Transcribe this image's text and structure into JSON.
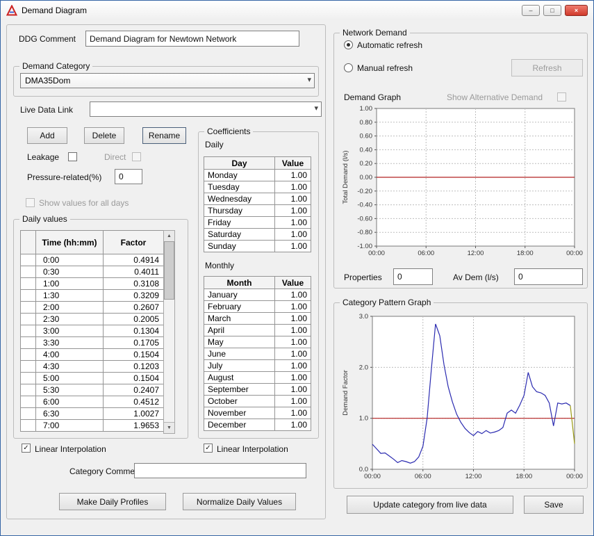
{
  "window": {
    "title": "Demand Diagram"
  },
  "icons": {
    "minimize": "–",
    "maximize": "□",
    "close": "×",
    "dropdown": "▾",
    "check": "✓",
    "scroll_up": "▲",
    "scroll_down": "▼",
    "row_marker": "▶"
  },
  "left": {
    "ddg_comment_label": "DDG Comment",
    "ddg_comment_value": "Demand Diagram for Newtown Network",
    "demand_category": {
      "group_label": "Demand Category",
      "selected_category": "DMA35Dom",
      "live_data_link_label": "Live Data Link",
      "live_data_link_value": "",
      "add_button": "Add",
      "delete_button": "Delete",
      "rename_button": "Rename",
      "leakage_label": "Leakage",
      "direct_label": "Direct",
      "pressure_related_label": "Pressure-related(%)",
      "pressure_related_value": "0",
      "show_values_label": "Show values for all days"
    },
    "daily_values": {
      "group_label": "Daily values",
      "columns": [
        "Time (hh:mm)",
        "Factor"
      ],
      "rows": [
        [
          "0:00",
          "0.4914"
        ],
        [
          "0:30",
          "0.4011"
        ],
        [
          "1:00",
          "0.3108"
        ],
        [
          "1:30",
          "0.3209"
        ],
        [
          "2:00",
          "0.2607"
        ],
        [
          "2:30",
          "0.2005"
        ],
        [
          "3:00",
          "0.1304"
        ],
        [
          "3:30",
          "0.1705"
        ],
        [
          "4:00",
          "0.1504"
        ],
        [
          "4:30",
          "0.1203"
        ],
        [
          "5:00",
          "0.1504"
        ],
        [
          "5:30",
          "0.2407"
        ],
        [
          "6:00",
          "0.4512"
        ],
        [
          "6:30",
          "1.0027"
        ],
        [
          "7:00",
          "1.9653"
        ]
      ],
      "linear_interpolation_label": "Linear Interpolation"
    },
    "coefficients": {
      "group_label": "Coefficients",
      "daily_label": "Daily",
      "daily_columns": [
        "Day",
        "Value"
      ],
      "daily_rows": [
        [
          "Monday",
          "1.00"
        ],
        [
          "Tuesday",
          "1.00"
        ],
        [
          "Wednesday",
          "1.00"
        ],
        [
          "Thursday",
          "1.00"
        ],
        [
          "Friday",
          "1.00"
        ],
        [
          "Saturday",
          "1.00"
        ],
        [
          "Sunday",
          "1.00"
        ]
      ],
      "monthly_label": "Monthly",
      "monthly_columns": [
        "Month",
        "Value"
      ],
      "monthly_rows": [
        [
          "January",
          "1.00"
        ],
        [
          "February",
          "1.00"
        ],
        [
          "March",
          "1.00"
        ],
        [
          "April",
          "1.00"
        ],
        [
          "May",
          "1.00"
        ],
        [
          "June",
          "1.00"
        ],
        [
          "July",
          "1.00"
        ],
        [
          "August",
          "1.00"
        ],
        [
          "September",
          "1.00"
        ],
        [
          "October",
          "1.00"
        ],
        [
          "November",
          "1.00"
        ],
        [
          "December",
          "1.00"
        ]
      ],
      "linear_interpolation_label": "Linear Interpolation"
    },
    "category_comment_label": "Category Comment",
    "category_comment_value": "",
    "make_daily_profiles_button": "Make Daily Profiles",
    "normalize_daily_values_button": "Normalize Daily Values"
  },
  "right": {
    "network_demand": {
      "group_label": "Network Demand",
      "automatic_refresh_label": "Automatic refresh",
      "manual_refresh_label": "Manual refresh",
      "refresh_button": "Refresh",
      "demand_graph_label": "Demand Graph",
      "show_alternative_label": "Show Alternative Demand",
      "properties_label": "Properties",
      "properties_value": "0",
      "av_dem_label": "Av Dem (l/s)",
      "av_dem_value": "0"
    },
    "category_pattern_group_label": "Category Pattern Graph",
    "update_button": "Update category from live data",
    "save_button": "Save"
  },
  "chart_data": [
    {
      "id": "demand-graph",
      "type": "line",
      "title": "Demand Graph",
      "ylabel": "Total Demand (l/s)",
      "xlim": [
        0,
        24
      ],
      "ylim": [
        -1,
        1
      ],
      "xticks": [
        0,
        6,
        12,
        18,
        24
      ],
      "xtick_labels": [
        "00:00",
        "06:00",
        "12:00",
        "18:00",
        "00:00"
      ],
      "yticks": [
        1,
        0.8,
        0.6,
        0.4,
        0.2,
        0,
        -0.2,
        -0.4,
        -0.6,
        -0.8,
        -1
      ],
      "ytick_labels": [
        "1.00",
        "0.80",
        "0.60",
        "0.40",
        "0.20",
        "0.00",
        "-0.20",
        "-0.40",
        "-0.60",
        "-0.80",
        "-1.00"
      ],
      "grid": true,
      "legend": false,
      "series": [
        {
          "name": "total-demand",
          "color": "#b22020",
          "x": [
            0,
            24
          ],
          "values": [
            0,
            0
          ]
        }
      ]
    },
    {
      "id": "category-pattern-graph",
      "type": "line",
      "title": "Category Pattern Graph",
      "ylabel": "Demand Factor",
      "xlim": [
        0,
        24
      ],
      "ylim": [
        0,
        3
      ],
      "xticks": [
        0,
        6,
        12,
        18,
        24
      ],
      "xtick_labels": [
        "00:00",
        "06:00",
        "12:00",
        "18:00",
        "00:00"
      ],
      "yticks": [
        0,
        1,
        2,
        3
      ],
      "ytick_labels": [
        "0.0",
        "1.0",
        "2.0",
        "3.0"
      ],
      "grid": true,
      "legend": false,
      "series": [
        {
          "name": "reference-line",
          "color": "#b22020",
          "x": [
            0,
            24
          ],
          "values": [
            1,
            1
          ]
        },
        {
          "name": "demand-factor",
          "color": "#2a2ab0",
          "x_start": 0,
          "x_step": 0.5,
          "values": [
            0.4914,
            0.4011,
            0.3108,
            0.3209,
            0.2607,
            0.2005,
            0.1304,
            0.1705,
            0.1504,
            0.1203,
            0.1504,
            0.2407,
            0.4512,
            1.0027,
            1.9653,
            2.85,
            2.62,
            2.05,
            1.62,
            1.32,
            1.08,
            0.92,
            0.8,
            0.72,
            0.66,
            0.74,
            0.7,
            0.76,
            0.71,
            0.73,
            0.76,
            0.82,
            1.1,
            1.16,
            1.1,
            1.26,
            1.45,
            1.9,
            1.62,
            1.52,
            1.5,
            1.45,
            1.3,
            0.85,
            1.3,
            1.28,
            1.3,
            1.25
          ]
        },
        {
          "name": "demand-factor-tail",
          "color": "#9a9a10",
          "x": [
            23.5,
            24
          ],
          "values": [
            1.25,
            0.5
          ]
        }
      ]
    }
  ]
}
